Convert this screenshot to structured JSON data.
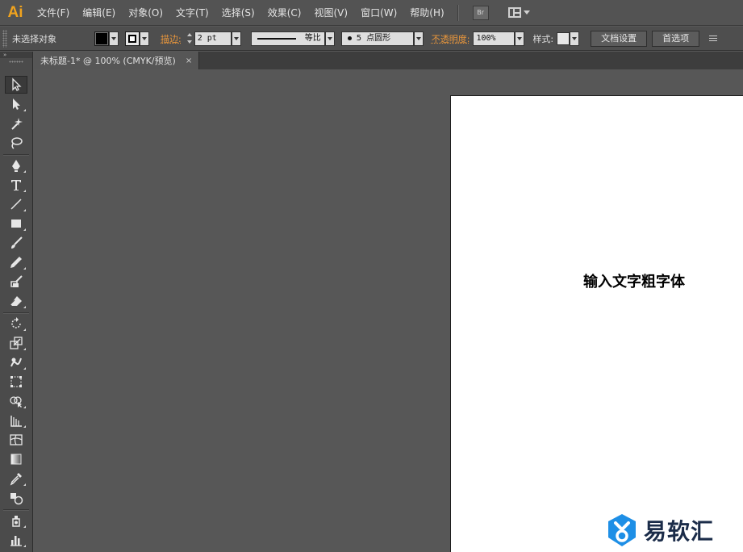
{
  "app": {
    "logo_text": "Ai"
  },
  "menu": {
    "items": [
      {
        "label": "文件(F)"
      },
      {
        "label": "编辑(E)"
      },
      {
        "label": "对象(O)"
      },
      {
        "label": "文字(T)"
      },
      {
        "label": "选择(S)"
      },
      {
        "label": "效果(C)"
      },
      {
        "label": "视图(V)"
      },
      {
        "label": "窗口(W)"
      },
      {
        "label": "帮助(H)"
      }
    ],
    "bridge_label": "Br"
  },
  "control_bar": {
    "selection_status": "未选择对象",
    "stroke_label": "描边:",
    "stroke_weight": "2 pt",
    "stroke_profile": "等比",
    "brush_size": "5",
    "brush_shape": "点圆形",
    "opacity_label": "不透明度:",
    "opacity_value": "100%",
    "style_label": "样式:",
    "doc_setup_label": "文档设置",
    "preferences_label": "首选项"
  },
  "document": {
    "tab_title": "未标题-1* @ 100% (CMYK/预览)",
    "tab_close": "×"
  },
  "artboard": {
    "text": "输入文字粗字体"
  },
  "watermark": {
    "text": "易软汇"
  },
  "colors": {
    "brand": "#f0a31e",
    "label_orange": "#e8963c",
    "ui_dark": "#535353",
    "canvas": "#575757",
    "watermark_blue": "#1e8fe6"
  },
  "toolbox": {
    "collapse_glyph": "»",
    "tools": [
      {
        "icon": "selection-arrow-icon"
      },
      {
        "icon": "direct-selection-arrow-icon"
      },
      {
        "icon": "magic-wand-icon"
      },
      {
        "icon": "lasso-icon"
      },
      {
        "icon": "pen-icon"
      },
      {
        "icon": "type-icon"
      },
      {
        "icon": "line-segment-icon"
      },
      {
        "icon": "rectangle-icon"
      },
      {
        "icon": "paintbrush-icon"
      },
      {
        "icon": "pencil-icon"
      },
      {
        "icon": "blob-brush-icon"
      },
      {
        "icon": "eraser-icon"
      },
      {
        "icon": "rotate-icon"
      },
      {
        "icon": "scale-icon"
      },
      {
        "icon": "warp-icon"
      },
      {
        "icon": "free-transform-icon"
      },
      {
        "icon": "shape-builder-icon"
      },
      {
        "icon": "perspective-grid-icon"
      },
      {
        "icon": "mesh-icon"
      },
      {
        "icon": "gradient-icon"
      },
      {
        "icon": "eyedropper-icon"
      },
      {
        "icon": "blend-icon"
      },
      {
        "icon": "symbol-sprayer-icon"
      },
      {
        "icon": "column-graph-icon"
      }
    ]
  }
}
